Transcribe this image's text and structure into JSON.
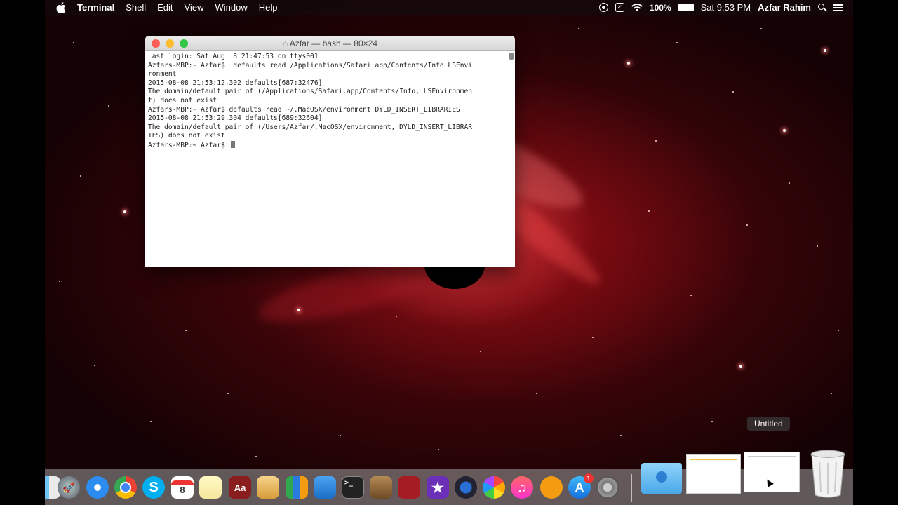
{
  "menubar": {
    "app_name": "Terminal",
    "items": [
      "Shell",
      "Edit",
      "View",
      "Window",
      "Help"
    ],
    "battery": "100%",
    "clock": "Sat 9:53 PM",
    "user": "Azfar Rahim"
  },
  "terminal": {
    "title": "Azfar — bash — 80×24",
    "lines": [
      "Last login: Sat Aug  8 21:47:53 on ttys001",
      "Azfars-MBP:~ Azfar$  defaults read /Applications/Safari.app/Contents/Info LSEnvi",
      "ronment",
      "2015-08-08 21:53:12.302 defaults[687:32476]",
      "The domain/default pair of (/Applications/Safari.app/Contents/Info, LSEnvironmen",
      "t) does not exist",
      "Azfars-MBP:~ Azfar$ defaults read ~/.MacOSX/environment DYLD_INSERT_LIBRARIES",
      "2015-08-08 21:53:29.304 defaults[689:32604]",
      "The domain/default pair of (/Users/Azfar/.MacOSX/environment, DYLD_INSERT_LIBRAR",
      "IES) does not exist"
    ],
    "prompt": "Azfars-MBP:~ Azfar$ "
  },
  "tooltip": "Untitled",
  "dock": {
    "calendar_day": "8",
    "app_store_badge": "1",
    "icons": [
      "finder-icon",
      "launchpad-icon",
      "safari-icon",
      "chrome-icon",
      "skype-icon",
      "calendar-icon",
      "notes-icon",
      "dictionary-icon",
      "preview-icon",
      "numbers-icon",
      "keynote-icon",
      "terminal-icon",
      "archive-icon",
      "photo-booth-icon",
      "imovie-icon",
      "camera-icon",
      "photos-icon",
      "itunes-icon",
      "ibooks-icon",
      "app-store-icon",
      "system-preferences-icon",
      "downloads-folder-icon",
      "untitled-doc-icon",
      "textedit-doc-icon",
      "trash-icon"
    ]
  },
  "colors": {
    "accent_red": "#c8141e",
    "close": "#fc5f57",
    "minimize": "#fdbc2e",
    "maximize": "#33c748"
  }
}
